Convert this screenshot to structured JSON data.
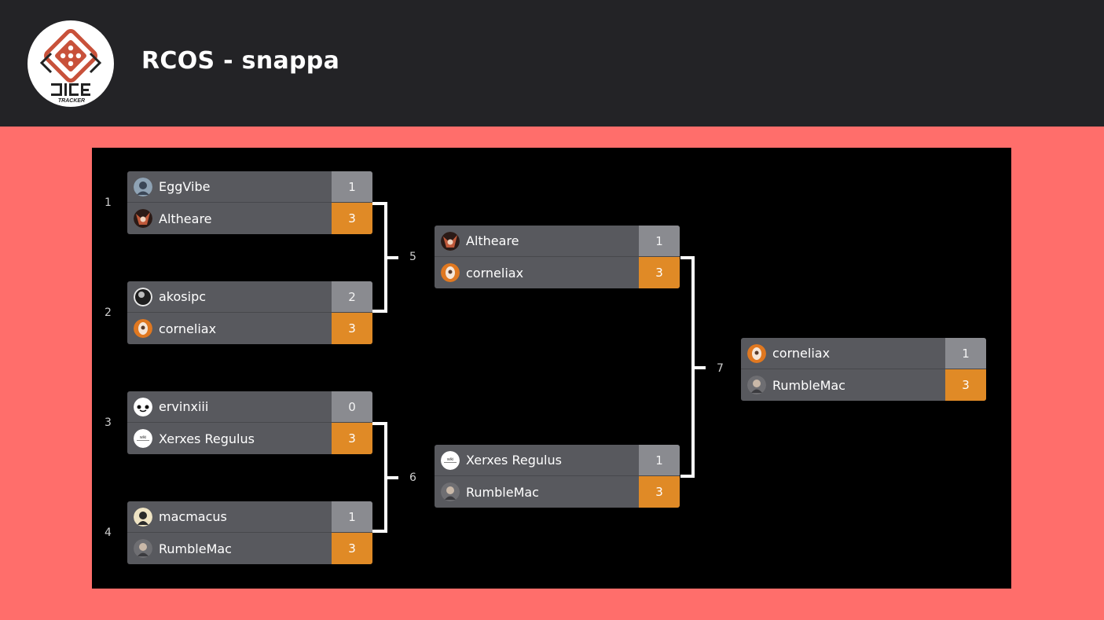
{
  "header": {
    "title": "RCOS - snappa",
    "logo_label": "DICE TRACKER"
  },
  "colors": {
    "background": "#ff6e6b",
    "header": "#232326",
    "panel": "#000000",
    "row": "#58595e",
    "loser_score": "#8a8b90",
    "winner_score": "#e08a26"
  },
  "matches": {
    "m1": {
      "number": "1",
      "p1": {
        "name": "EggVibe",
        "score": "1"
      },
      "p2": {
        "name": "Altheare",
        "score": "3"
      }
    },
    "m2": {
      "number": "2",
      "p1": {
        "name": "akosipc",
        "score": "2"
      },
      "p2": {
        "name": "corneliax",
        "score": "3"
      }
    },
    "m3": {
      "number": "3",
      "p1": {
        "name": "ervinxiii",
        "score": "0"
      },
      "p2": {
        "name": "Xerxes Regulus",
        "score": "3"
      }
    },
    "m4": {
      "number": "4",
      "p1": {
        "name": "macmacus",
        "score": "1"
      },
      "p2": {
        "name": "RumbleMac",
        "score": "3"
      }
    },
    "m5": {
      "number": "5",
      "p1": {
        "name": "Altheare",
        "score": "1"
      },
      "p2": {
        "name": "corneliax",
        "score": "3"
      }
    },
    "m6": {
      "number": "6",
      "p1": {
        "name": "Xerxes Regulus",
        "score": "1"
      },
      "p2": {
        "name": "RumbleMac",
        "score": "3"
      }
    },
    "m7": {
      "number": "7",
      "p1": {
        "name": "corneliax",
        "score": "1"
      },
      "p2": {
        "name": "RumbleMac",
        "score": "3"
      }
    }
  },
  "avatars": {
    "EggVibe": "avatar-icon",
    "Altheare": "avatar-icon",
    "akosipc": "avatar-icon",
    "corneliax": "avatar-icon",
    "ervinxiii": "avatar-icon",
    "Xerxes Regulus": "wiki-avatar-icon",
    "macmacus": "avatar-icon",
    "RumbleMac": "avatar-icon"
  }
}
